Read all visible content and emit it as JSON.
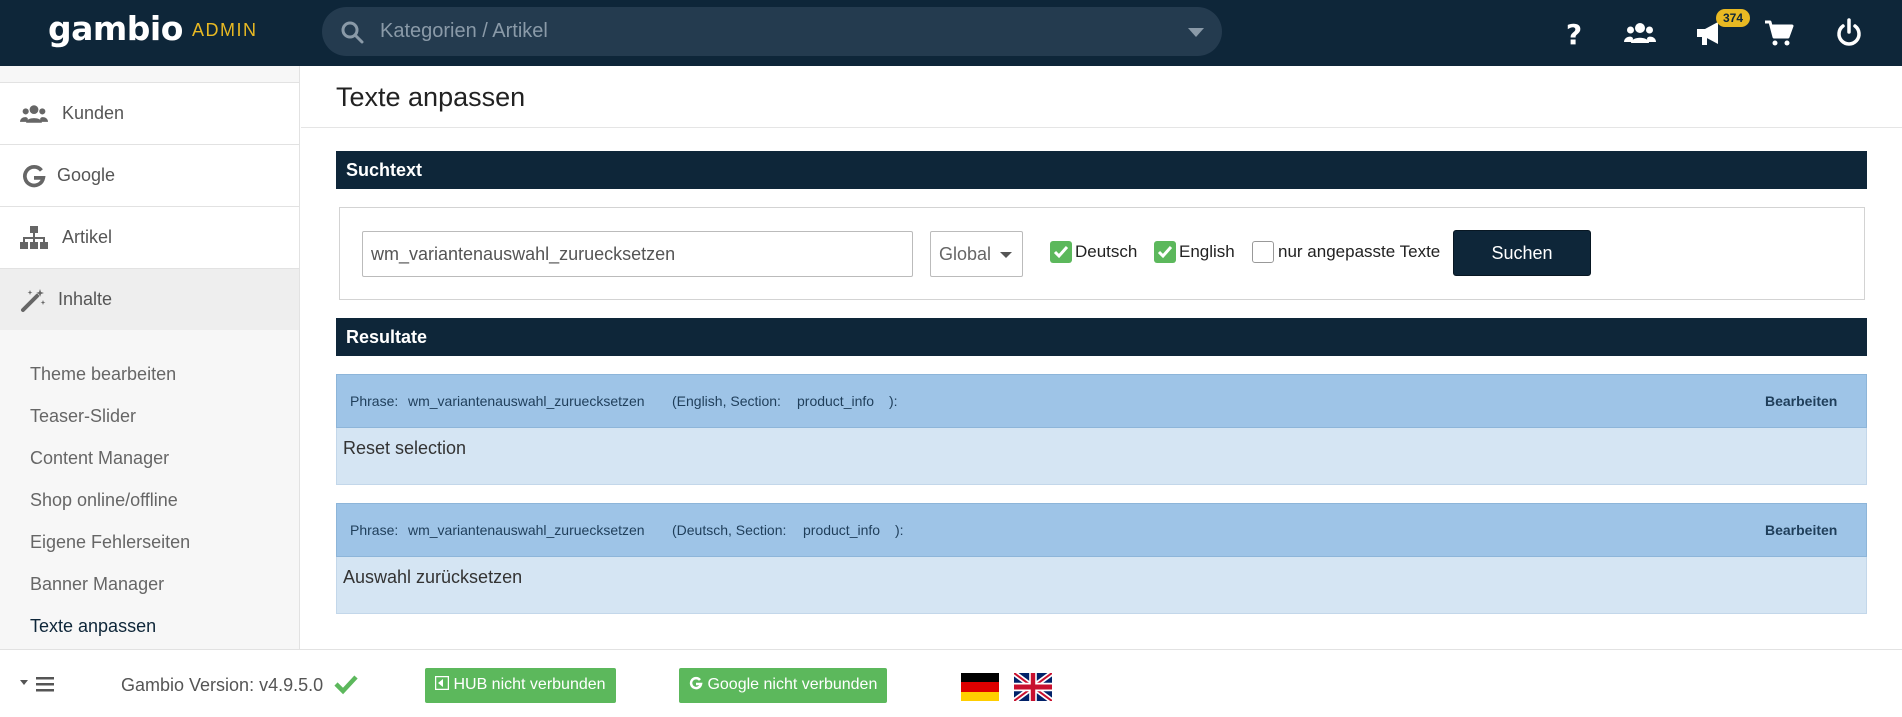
{
  "header": {
    "logo": "gambio",
    "admin_label": "ADMIN",
    "search_placeholder": "Kategorien / Artikel",
    "notification_count": "374",
    "colors": {
      "bar": "#0e2639",
      "accent": "#e8b923"
    },
    "icons": [
      "help-icon",
      "users-icon",
      "megaphone-icon",
      "cart-icon",
      "power-icon"
    ]
  },
  "sidebar": {
    "items": [
      {
        "label": "Kunden",
        "icon": "users-icon"
      },
      {
        "label": "Google",
        "icon": "google-icon"
      },
      {
        "label": "Artikel",
        "icon": "sitemap-icon"
      },
      {
        "label": "Inhalte",
        "icon": "magic-wand-icon"
      }
    ],
    "subitems": [
      "Theme bearbeiten",
      "Teaser-Slider",
      "Content Manager",
      "Shop online/offline",
      "Eigene Fehlerseiten",
      "Banner Manager",
      "Texte anpassen"
    ]
  },
  "main": {
    "title": "Texte anpassen",
    "search_section": {
      "heading": "Suchtext",
      "input_value": "wm_variantenauswahl_zuruecksetzen",
      "scope_select": "Global",
      "checkbox_deutsch": {
        "label": "Deutsch",
        "checked": true
      },
      "checkbox_english": {
        "label": "English",
        "checked": true
      },
      "checkbox_custom": {
        "label": "nur angepasste Texte",
        "checked": false
      },
      "button": "Suchen"
    },
    "results_section": {
      "heading": "Resultate",
      "results": [
        {
          "phrase_label": "Phrase:",
          "phrase": "wm_variantenauswahl_zuruecksetzen",
          "language_section": "(English, Section:",
          "section": "product_info",
          "closing": "):",
          "edit_label": "Bearbeiten",
          "text": "Reset selection"
        },
        {
          "phrase_label": "Phrase:",
          "phrase": "wm_variantenauswahl_zuruecksetzen",
          "language_section": "(Deutsch, Section:",
          "section": "product_info",
          "closing": "):",
          "edit_label": "Bearbeiten",
          "text": "Auswahl zurücksetzen"
        }
      ]
    }
  },
  "footer": {
    "version": "Gambio Version: v4.9.5.0",
    "hub_button": "HUB nicht verbunden",
    "google_button": "Google nicht verbunden",
    "flags": [
      "german-flag-icon",
      "uk-flag-icon"
    ]
  }
}
